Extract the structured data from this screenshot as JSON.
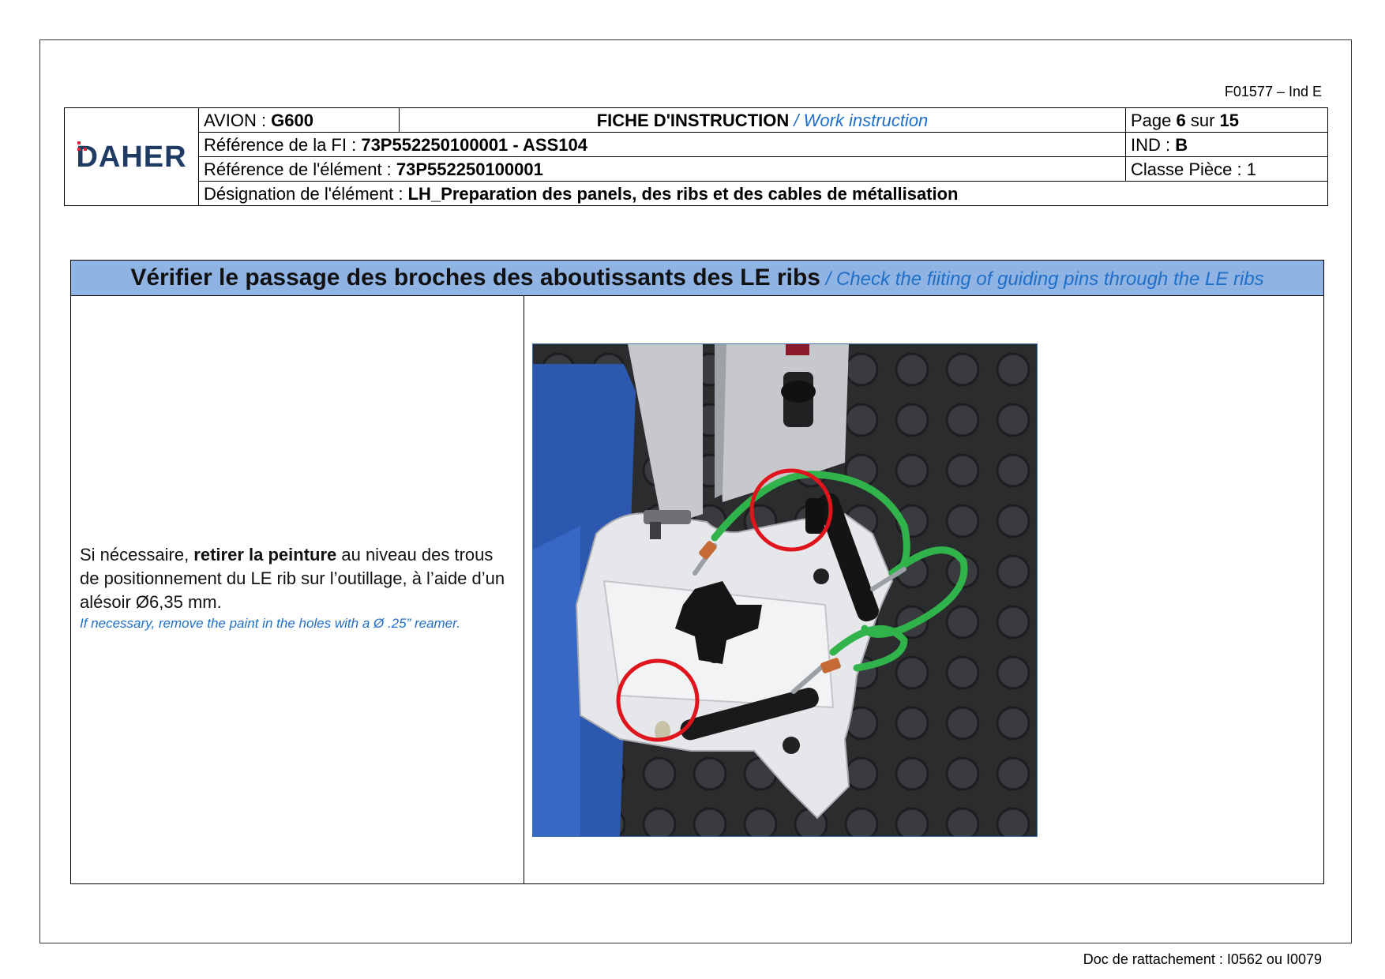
{
  "form_code": "F01577 – Ind E",
  "logo": {
    "text": "DAHER",
    "dot_color": "#d52b3a",
    "text_color": "#1f3b63"
  },
  "header": {
    "avion_label": "AVION : ",
    "avion_value": "G600",
    "doc_type": "FICHE D'INSTRUCTION",
    "doc_type_en": " / Work instruction",
    "page_label": "Page ",
    "page_current": "6",
    "page_sep": " sur ",
    "page_total": "15",
    "ref_fi_label": "Référence de la FI : ",
    "ref_fi_value": "73P552250100001 - ASS104",
    "ind_label": "IND : ",
    "ind_value": "B",
    "ref_elem_label": "Référence de l'élément : ",
    "ref_elem_value": "73P552250100001",
    "classe": "Classe Pièce : 1",
    "designation_label": "Désignation de l'élément : ",
    "designation_value": "LH_Preparation des panels, des ribs et des cables de métallisation"
  },
  "section": {
    "title_fr": "Vérifier le passage des broches des aboutissants des LE ribs",
    "title_en": " / Check the fiiting of guiding pins through the LE ribs",
    "title_bg": "#8fb3e3",
    "instruction_fr_1": "Si nécessaire, ",
    "instruction_fr_bold": "retirer la peinture",
    "instruction_fr_2": " au niveau des trous de positionnement du LE rib sur l’outillage, à l’aide d’un alésoir Ø6,35 mm.",
    "instruction_en": "If necessary, remove the paint in the holes with a Ø .25” reamer."
  },
  "footer": "Doc de rattachement : I0562 ou I0079"
}
